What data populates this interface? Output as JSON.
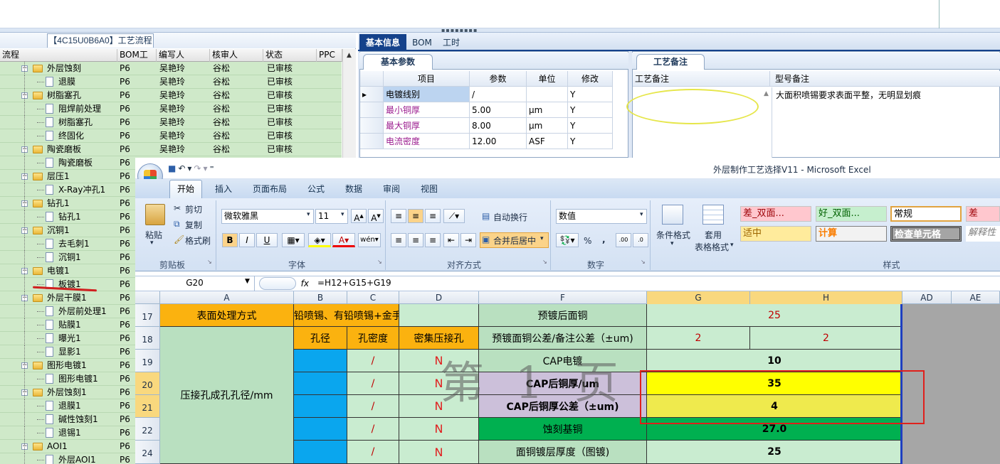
{
  "left_panel": {
    "tab_title": "【4C15U0B6A0】工艺流程",
    "columns": [
      "流程",
      "BOM工厂",
      "编写人",
      "核审人",
      "状态",
      "PPC"
    ],
    "rows": [
      {
        "name": "外层蚀刻",
        "type": "folder",
        "level": 1,
        "bom": "P6",
        "writer": "吴艳玲",
        "reviewer": "谷松",
        "status": "已审核"
      },
      {
        "name": "退膜",
        "type": "doc",
        "level": 2,
        "bom": "P6",
        "writer": "吴艳玲",
        "reviewer": "谷松",
        "status": "已审核"
      },
      {
        "name": "树脂塞孔",
        "type": "folder",
        "level": 1,
        "bom": "P6",
        "writer": "吴艳玲",
        "reviewer": "谷松",
        "status": "已审核"
      },
      {
        "name": "阻焊前处理",
        "type": "doc",
        "level": 2,
        "bom": "P6",
        "writer": "吴艳玲",
        "reviewer": "谷松",
        "status": "已审核"
      },
      {
        "name": "树脂塞孔",
        "type": "doc",
        "level": 2,
        "bom": "P6",
        "writer": "吴艳玲",
        "reviewer": "谷松",
        "status": "已审核"
      },
      {
        "name": "终固化",
        "type": "doc",
        "level": 2,
        "bom": "P6",
        "writer": "吴艳玲",
        "reviewer": "谷松",
        "status": "已审核"
      },
      {
        "name": "陶瓷磨板",
        "type": "folder",
        "level": 1,
        "bom": "P6",
        "writer": "吴艳玲",
        "reviewer": "谷松",
        "status": "已审核"
      },
      {
        "name": "陶瓷磨板",
        "type": "doc",
        "level": 2,
        "bom": "P6",
        "writer": "",
        "reviewer": "",
        "status": ""
      },
      {
        "name": "层压1",
        "type": "folder",
        "level": 1,
        "bom": "P6",
        "writer": "",
        "reviewer": "",
        "status": ""
      },
      {
        "name": "X-Ray冲孔1",
        "type": "doc",
        "level": 2,
        "bom": "P6",
        "writer": "",
        "reviewer": "",
        "status": ""
      },
      {
        "name": "钻孔1",
        "type": "folder",
        "level": 1,
        "bom": "P6",
        "writer": "",
        "reviewer": "",
        "status": ""
      },
      {
        "name": "钻孔1",
        "type": "doc",
        "level": 2,
        "bom": "P6",
        "writer": "",
        "reviewer": "",
        "status": ""
      },
      {
        "name": "沉铜1",
        "type": "folder",
        "level": 1,
        "bom": "P6",
        "writer": "",
        "reviewer": "",
        "status": ""
      },
      {
        "name": "去毛刺1",
        "type": "doc",
        "level": 2,
        "bom": "P6",
        "writer": "",
        "reviewer": "",
        "status": ""
      },
      {
        "name": "沉铜1",
        "type": "doc",
        "level": 2,
        "bom": "P6",
        "writer": "",
        "reviewer": "",
        "status": ""
      },
      {
        "name": "电镀1",
        "type": "folder",
        "level": 1,
        "bom": "P6",
        "writer": "",
        "reviewer": "",
        "status": ""
      },
      {
        "name": "板镀1",
        "type": "doc",
        "level": 2,
        "bom": "P6",
        "writer": "",
        "reviewer": "",
        "status": "",
        "selected": true
      },
      {
        "name": "外层干膜1",
        "type": "folder",
        "level": 1,
        "bom": "P6",
        "writer": "",
        "reviewer": "",
        "status": ""
      },
      {
        "name": "外层前处理1",
        "type": "doc",
        "level": 2,
        "bom": "P6",
        "writer": "",
        "reviewer": "",
        "status": ""
      },
      {
        "name": "贴膜1",
        "type": "doc",
        "level": 2,
        "bom": "P6",
        "writer": "",
        "reviewer": "",
        "status": ""
      },
      {
        "name": "曝光1",
        "type": "doc",
        "level": 2,
        "bom": "P6",
        "writer": "",
        "reviewer": "",
        "status": ""
      },
      {
        "name": "显影1",
        "type": "doc",
        "level": 2,
        "bom": "P6",
        "writer": "",
        "reviewer": "",
        "status": ""
      },
      {
        "name": "图形电镀1",
        "type": "folder",
        "level": 1,
        "bom": "P6",
        "writer": "",
        "reviewer": "",
        "status": ""
      },
      {
        "name": "图形电镀1",
        "type": "doc",
        "level": 2,
        "bom": "P6",
        "writer": "",
        "reviewer": "",
        "status": ""
      },
      {
        "name": "外层蚀刻1",
        "type": "folder",
        "level": 1,
        "bom": "P6",
        "writer": "",
        "reviewer": "",
        "status": ""
      },
      {
        "name": "退膜1",
        "type": "doc",
        "level": 2,
        "bom": "P6",
        "writer": "",
        "reviewer": "",
        "status": ""
      },
      {
        "name": "碱性蚀刻1",
        "type": "doc",
        "level": 2,
        "bom": "P6",
        "writer": "",
        "reviewer": "",
        "status": ""
      },
      {
        "name": "退锡1",
        "type": "doc",
        "level": 2,
        "bom": "P6",
        "writer": "",
        "reviewer": "",
        "status": ""
      },
      {
        "name": "AOI1",
        "type": "folder",
        "level": 1,
        "bom": "P6",
        "writer": "",
        "reviewer": "",
        "status": ""
      },
      {
        "name": "外层AOI1",
        "type": "doc",
        "level": 2,
        "bom": "P6",
        "writer": "",
        "reviewer": "",
        "status": ""
      }
    ]
  },
  "right_panel": {
    "tabs": [
      "基本信息",
      "BOM",
      "工时"
    ],
    "params_tab": "基本参数",
    "params_columns": [
      "项目",
      "参数",
      "单位",
      "修改"
    ],
    "params": [
      {
        "item": "电镀线别",
        "value": "/",
        "unit": "",
        "edit": "Y"
      },
      {
        "item": "最小铜厚",
        "value": "5.00",
        "unit": "μm",
        "edit": "Y"
      },
      {
        "item": "最大铜厚",
        "value": "8.00",
        "unit": "μm",
        "edit": "Y"
      },
      {
        "item": "电流密度",
        "value": "12.00",
        "unit": "ASF",
        "edit": "Y"
      }
    ],
    "notes_tab": "工艺备注",
    "notes_columns": [
      "工艺备注",
      "型号备注"
    ],
    "process_note": "",
    "model_note": "大面积喷锡要求表面平整，无明显划痕"
  },
  "excel": {
    "title": "外层制作工艺选择V11 - Microsoft Excel",
    "ribbon_tabs": [
      "开始",
      "插入",
      "页面布局",
      "公式",
      "数据",
      "审阅",
      "视图"
    ],
    "clipboard": {
      "paste": "粘贴",
      "cut": "剪切",
      "copy": "复制",
      "format_painter": "格式刷",
      "label": "剪贴板"
    },
    "font": {
      "name": "微软雅黑",
      "size": "11",
      "label": "字体",
      "bold": "B",
      "italic": "I",
      "underline": "U"
    },
    "alignment": {
      "wrap": "自动换行",
      "merge": "合并后居中",
      "label": "对齐方式"
    },
    "number": {
      "format": "数值",
      "label": "数字",
      "percent": "%",
      "comma": ","
    },
    "styles": {
      "conditional": "条件格式",
      "table": "套用",
      "table2": "表格格式",
      "label": "样式",
      "cells": [
        "差_双面...",
        "好_双面...",
        "常规",
        "差",
        "适中",
        "计算",
        "检查单元格",
        "解释性"
      ]
    },
    "name_box": "G20",
    "fx": "fx",
    "formula": "=H12+G15+G19",
    "columns": [
      "A",
      "B",
      "C",
      "D",
      "F",
      "G",
      "H",
      "AD",
      "AE"
    ],
    "row_numbers": [
      "17",
      "18",
      "19",
      "20",
      "21",
      "22",
      "24"
    ],
    "cells": {
      "a17": "表面处理方式",
      "bc17": "铅喷锡、有铅喷锡+金手",
      "a_merged": "压接孔成孔孔径/mm",
      "b18": "孔径",
      "c18": "孔密度",
      "d18": "密集压接孔",
      "slash": "/",
      "n": "N",
      "f17": "预镀后面铜",
      "gh17": "25",
      "f18": "预镀面铜公差/备注公差（±um)",
      "g18": "2",
      "h18": "2",
      "f19": "CAP电镀",
      "gh19": "10",
      "f20": "CAP后铜厚/um",
      "gh20": "35",
      "f21": "CAP后铜厚公差（±um)",
      "gh21": "4",
      "f22": "蚀刻基铜",
      "gh22": "27.0",
      "f24": "面铜镀层厚度（图镀)",
      "gh24": "25"
    },
    "watermark": "第 1 页"
  }
}
